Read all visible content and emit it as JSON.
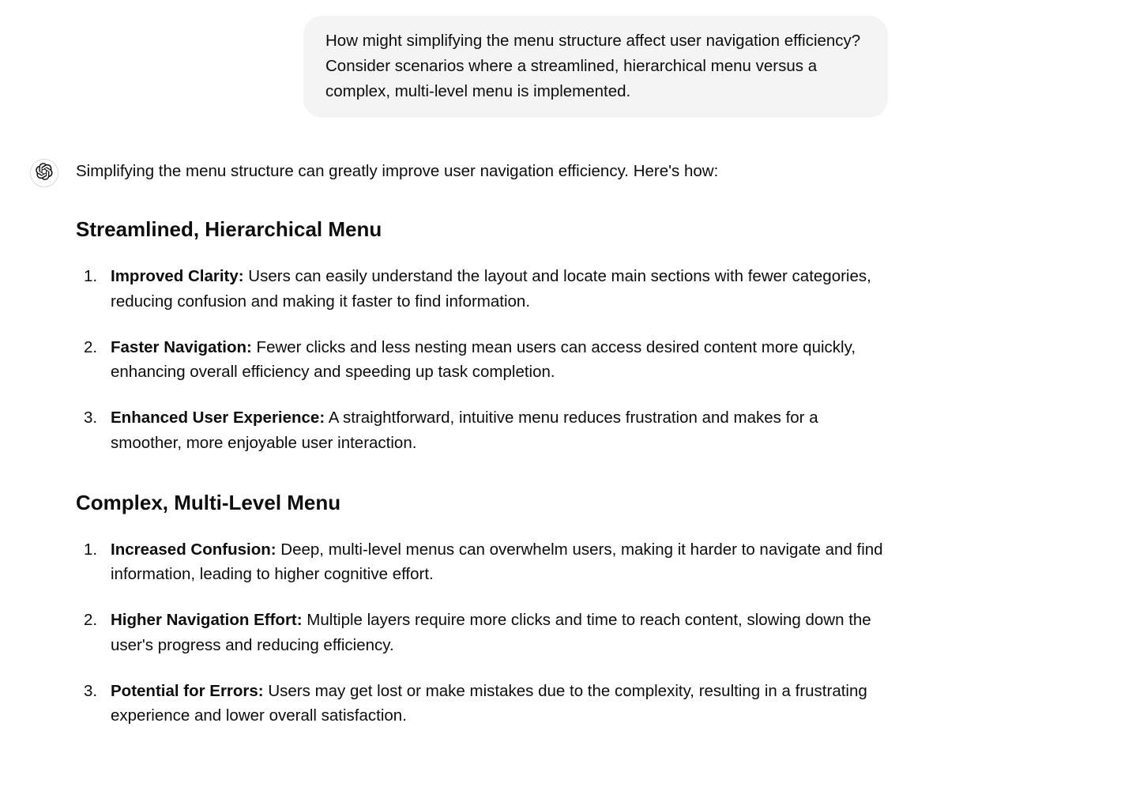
{
  "user_message": {
    "text": "How might simplifying the menu structure affect user navigation efficiency? Consider scenarios where a streamlined, hierarchical menu versus a complex, multi-level menu is implemented."
  },
  "assistant_message": {
    "intro": "Simplifying the menu structure can greatly improve user navigation efficiency. Here's how:",
    "sections": [
      {
        "heading": "Streamlined, Hierarchical Menu",
        "items": [
          {
            "title": "Improved Clarity:",
            "body": " Users can easily understand the layout and locate main sections with fewer categories, reducing confusion and making it faster to find information."
          },
          {
            "title": "Faster Navigation:",
            "body": " Fewer clicks and less nesting mean users can access desired content more quickly, enhancing overall efficiency and speeding up task completion."
          },
          {
            "title": "Enhanced User Experience:",
            "body": " A straightforward, intuitive menu reduces frustration and makes for a smoother, more enjoyable user interaction."
          }
        ]
      },
      {
        "heading": "Complex, Multi-Level Menu",
        "items": [
          {
            "title": "Increased Confusion:",
            "body": " Deep, multi-level menus can overwhelm users, making it harder to navigate and find information, leading to higher cognitive effort."
          },
          {
            "title": "Higher Navigation Effort:",
            "body": " Multiple layers require more clicks and time to reach content, slowing down the user's progress and reducing efficiency."
          },
          {
            "title": "Potential for Errors:",
            "body": " Users may get lost or make mistakes due to the complexity, resulting in a frustrating experience and lower overall satisfaction."
          }
        ]
      }
    ]
  }
}
